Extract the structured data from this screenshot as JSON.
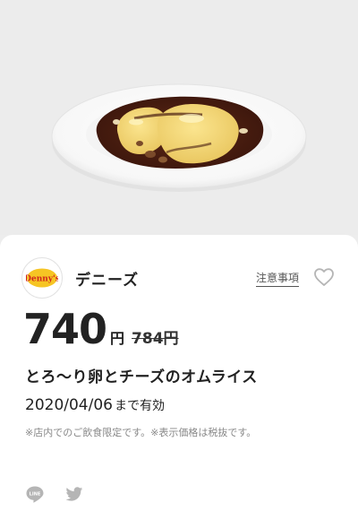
{
  "hero": {
    "image": "omurice-with-demi-glace-sauce-on-white-plate"
  },
  "store": {
    "logo_icon": "dennys-logo-icon",
    "logo_text": "Denny's",
    "name": "デニーズ"
  },
  "actions": {
    "notice_label": "注意事項",
    "favorite_icon": "heart-outline-icon"
  },
  "coupon": {
    "price": "740",
    "yen": "円",
    "original_price": "784円",
    "product_name": "とろ〜り卵とチーズのオムライス",
    "valid_date": "2020/04/06",
    "valid_suffix": "まで有効",
    "note": "※店内でのご飲食限定です。※表示価格は税抜です。"
  },
  "share": {
    "items": [
      {
        "icon": "line-icon",
        "label": "LINE"
      },
      {
        "icon": "twitter-icon",
        "label": "Twitter"
      }
    ]
  },
  "colors": {
    "background": "#ececec",
    "card": "#ffffff",
    "sauce": "#4a1e12",
    "egg": "#f2d46b",
    "icon_gray": "#b5b5b5",
    "logo_yellow": "#f6c524",
    "logo_red": "#d0261c"
  }
}
